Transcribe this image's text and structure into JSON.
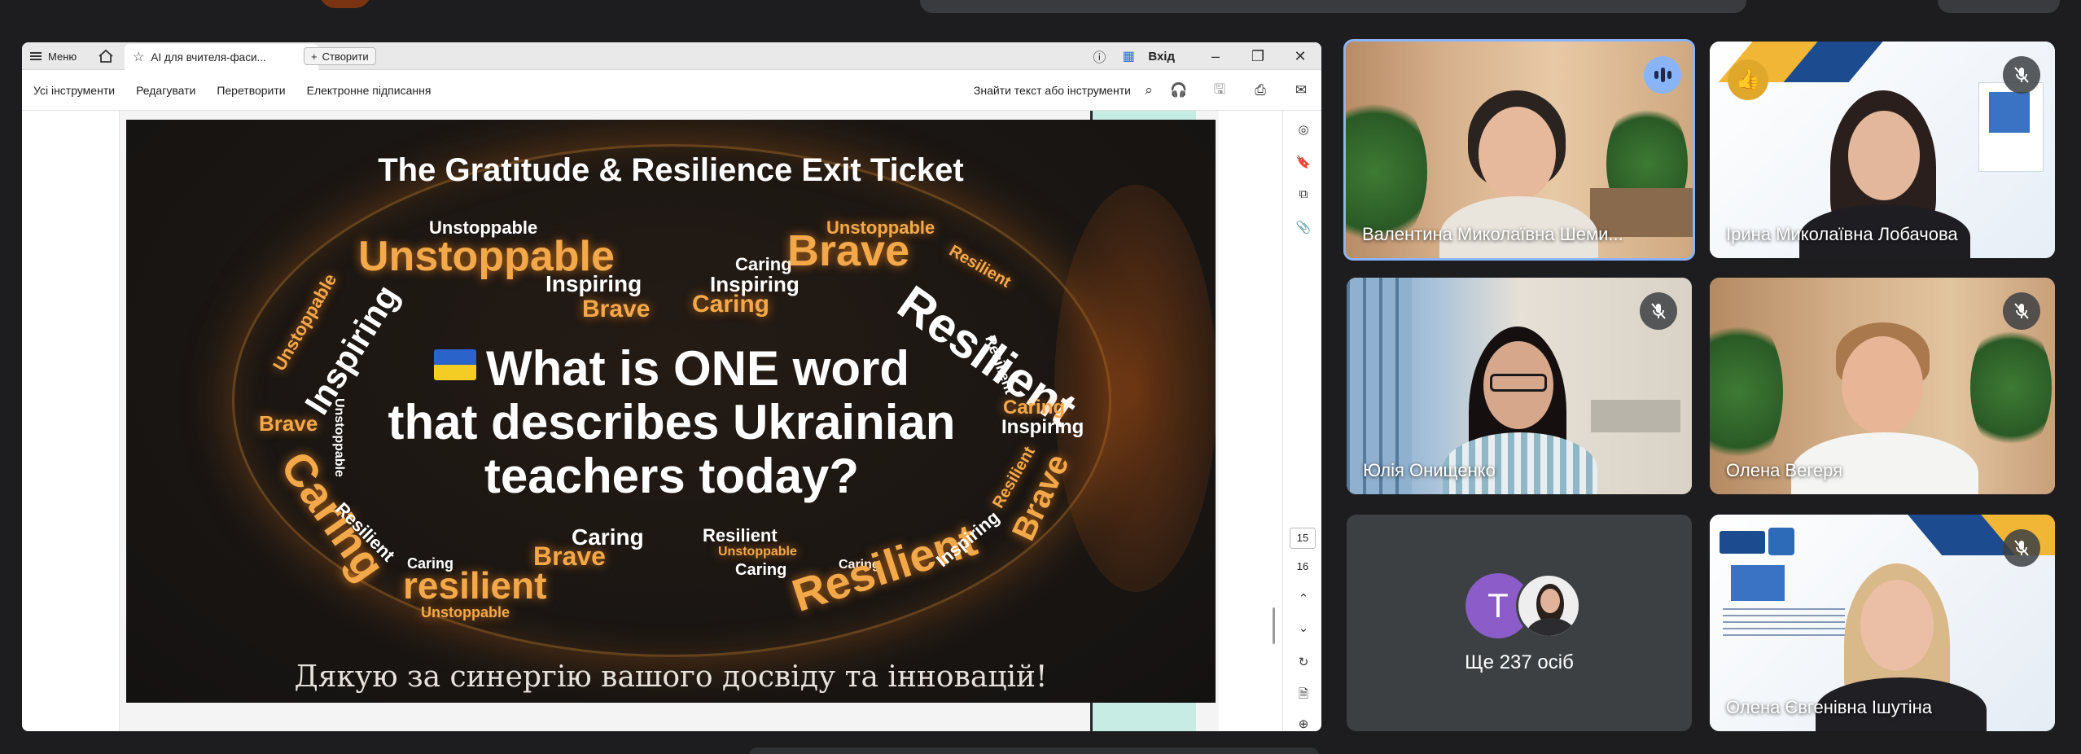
{
  "pdf_viewer": {
    "menu_label": "Меню",
    "tab_title": "AI для вчителя-фаси...",
    "new_label": "Створити",
    "signin": "Вхід",
    "tools": [
      "Усі інструменти",
      "Редагувати",
      "Перетворити",
      "Електронне підписання"
    ],
    "find_placeholder": "Знайти текст або інструменти",
    "page_current": "15",
    "page_next": "16"
  },
  "slide": {
    "title": "The Gratitude & Resilience Exit Ticket",
    "question_line1": "What is ONE word",
    "question_line2": "that describes Ukrainian",
    "question_line3": "teachers today?",
    "thanks": "Дякую за синергію вашого досвіду та інновацій!",
    "words": {
      "w1": "Unstoppable",
      "w2": "Unstoppable",
      "w3": "Inspiring",
      "w4": "Brave",
      "w5": "Caring",
      "w6": "Inspiring",
      "w7": "Caring",
      "w8": "Unstoppable",
      "w9": "Brave",
      "w10": "Resilient",
      "w11": "Resilient",
      "w12": "Resilient",
      "w13": "Caring",
      "w14": "Inspiring",
      "w15": "Unstoppable",
      "w16": "Inspiring",
      "w17": "Brave",
      "w18": "Unstoppable",
      "w19": "Caring",
      "w20": "Resilient",
      "w21": "Caring",
      "w22": "Brave",
      "w23": "Caring",
      "w24": "resilient",
      "w25": "Unstoppable",
      "w26": "Resilient",
      "w27": "Unstoppable",
      "w28": "Caring",
      "w29": "Caring",
      "w30": "Resilient",
      "w31": "Inspiring",
      "w32": "Brave",
      "w33": "Resilient"
    }
  },
  "participants": [
    {
      "name": "Валентина Миколаївна Шеми...",
      "speaking": true
    },
    {
      "name": "Ірина Миколаївна Лобачова",
      "muted": true
    },
    {
      "name": "Юлія Онищенко",
      "muted": true
    },
    {
      "name": "Олена Вегеря",
      "muted": true
    },
    {
      "name": "Олена Євгенівна Ішутіна",
      "muted": true
    }
  ],
  "more": {
    "avatar_letter": "T",
    "label": "Ще 237 осіб"
  },
  "colors": {
    "accent_blue": "#8ab4f8",
    "speaker_border": "#8ab4f8",
    "avatar_purple": "#8c5cc9",
    "word_orange": "#f3a94a"
  }
}
